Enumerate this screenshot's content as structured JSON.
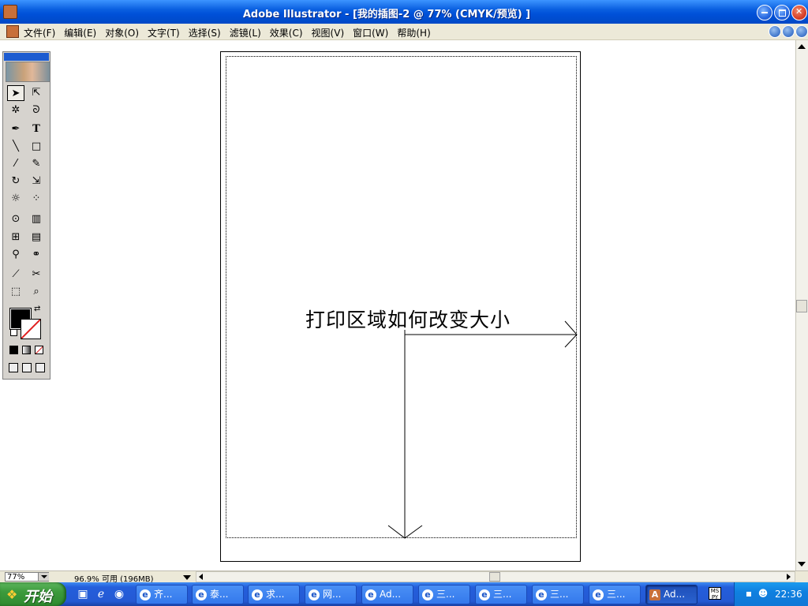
{
  "window": {
    "title": "Adobe Illustrator - [我的插图-2 @ 77% (CMYK/预览) ]"
  },
  "menu": {
    "items": [
      "文件(F)",
      "编辑(E)",
      "对象(O)",
      "文字(T)",
      "选择(S)",
      "滤镜(L)",
      "效果(C)",
      "视图(V)",
      "窗口(W)",
      "帮助(H)"
    ]
  },
  "toolbox": {
    "tools": [
      "selection-icon",
      "direct-selection-icon",
      "magic-wand-icon",
      "lasso-icon",
      "pen-icon",
      "type-icon",
      "line-icon",
      "rectangle-icon",
      "paintbrush-icon",
      "pencil-icon",
      "rotate-icon",
      "scale-icon",
      "warp-icon",
      "free-transform-icon",
      "symbol-sprayer-icon",
      "graph-icon",
      "mesh-icon",
      "gradient-icon",
      "eyedropper-icon",
      "blend-icon",
      "slice-icon",
      "scissors-icon",
      "hand-icon",
      "zoom-icon"
    ],
    "type_glyph": "T",
    "fill_color": "#000000",
    "stroke_color": "none"
  },
  "canvas": {
    "annotation": "打印区域如何改变大小"
  },
  "status": {
    "zoom": "77%",
    "info": "96.9% 可用 (196MB)"
  },
  "taskbar": {
    "start_label": "开始",
    "buttons": [
      "齐...",
      "泰...",
      "求...",
      "网...",
      "Ad...",
      "三...",
      "三...",
      "三...",
      "三...",
      "Ad..."
    ],
    "active_index": 9,
    "ime": "MS PY",
    "clock": "22:36"
  },
  "colors": {
    "titlebar": "#0a5fe0",
    "taskbar": "#245edb",
    "start_button": "#3c9a3c",
    "menubar": "#ece9d8",
    "toolbox": "#d6d3ce"
  }
}
